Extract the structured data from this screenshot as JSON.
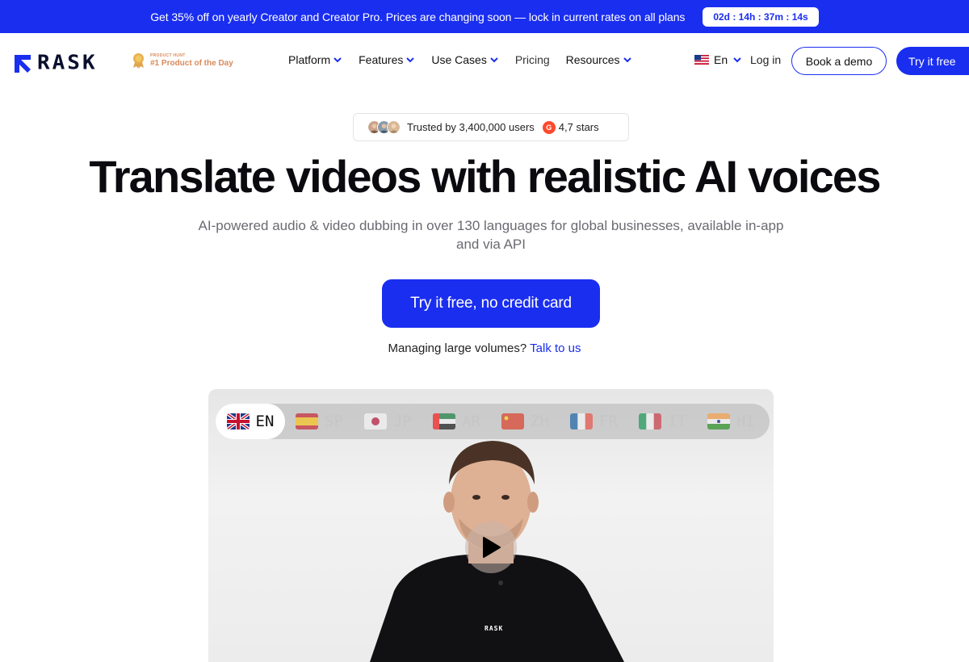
{
  "promo": {
    "text": "Get 35% off on yearly Creator and Creator Pro. Prices are changing soon — lock in current rates on all plans",
    "timer": "02d : 14h : 37m : 14s"
  },
  "nav": {
    "logo_text": "RASK",
    "producthunt_small": "PRODUCT HUNT",
    "producthunt_big": "#1 Product of the Day",
    "menu": {
      "platform": "Platform",
      "features": "Features",
      "use_cases": "Use Cases",
      "pricing": "Pricing",
      "resources": "Resources"
    },
    "language": "En",
    "login": "Log in",
    "book_demo": "Book a demo",
    "try_free": "Try it free"
  },
  "trust": {
    "text": "Trusted by 3,400,000 users",
    "g2_label": "G",
    "rating": "4,7 stars"
  },
  "hero": {
    "title": "Translate videos with realistic AI voices",
    "subtitle": "AI-powered audio & video dubbing in over 130 languages for global businesses, available in-app and via API",
    "cta": "Try it free, no credit card",
    "volumes_text": "Managing large volumes?",
    "volumes_link": "Talk to us"
  },
  "video": {
    "languages": [
      "EN",
      "SP",
      "JP",
      "AR",
      "ZH",
      "FR",
      "IT",
      "HI"
    ],
    "active_language": "EN",
    "shirt_logo": "RASK"
  },
  "colors": {
    "brand": "#1a2ef0",
    "producthunt": "#d98a5a",
    "g2": "#ff492c"
  }
}
